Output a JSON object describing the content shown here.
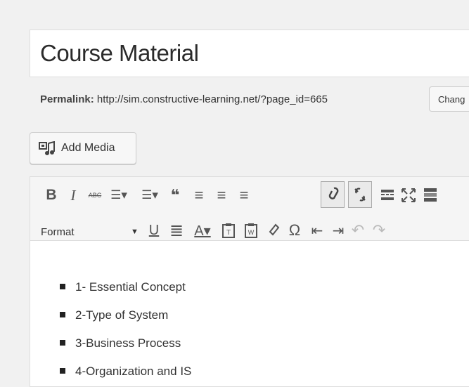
{
  "post": {
    "title": "Course Material",
    "permalink_label": "Permalink:",
    "permalink_url": "http://sim.constructive-learning.net/?page_id=665",
    "change_button": "Chang"
  },
  "media": {
    "add_media_label": "Add Media"
  },
  "toolbar": {
    "row1": [
      {
        "name": "bold-button",
        "glyph": "B"
      },
      {
        "name": "italic-button",
        "glyph": "I"
      },
      {
        "name": "strikethrough-button",
        "glyph": "ABC"
      },
      {
        "name": "bulleted-list-button",
        "glyph": "☰▾"
      },
      {
        "name": "numbered-list-button",
        "glyph": "☰▾"
      },
      {
        "name": "blockquote-button",
        "glyph": "❝"
      },
      {
        "name": "align-left-button",
        "glyph": "≡"
      },
      {
        "name": "align-center-button",
        "glyph": "≡"
      },
      {
        "name": "align-right-button",
        "glyph": "≡"
      },
      {
        "name": "insert-link-button",
        "glyph": "🔗"
      },
      {
        "name": "remove-link-button",
        "glyph": "⛓"
      },
      {
        "name": "read-more-button",
        "glyph": "▬"
      },
      {
        "name": "fullscreen-button",
        "glyph": "✕"
      },
      {
        "name": "toolbar-toggle-button",
        "glyph": "▦"
      }
    ],
    "row2": {
      "format_label": "Format",
      "buttons": [
        {
          "name": "underline-button",
          "glyph": "U"
        },
        {
          "name": "justify-button",
          "glyph": "≣"
        },
        {
          "name": "text-color-button",
          "glyph": "A▾"
        },
        {
          "name": "paste-text-button",
          "glyph": "T"
        },
        {
          "name": "clear-formatting-button",
          "glyph": "W"
        },
        {
          "name": "eraser-button",
          "glyph": "◇"
        },
        {
          "name": "special-character-button",
          "glyph": "Ω"
        },
        {
          "name": "outdent-button",
          "glyph": "⇤"
        },
        {
          "name": "indent-button",
          "glyph": "⇥"
        },
        {
          "name": "undo-button",
          "glyph": "↶"
        },
        {
          "name": "redo-button",
          "glyph": "↷"
        }
      ]
    }
  },
  "content": {
    "items": [
      "1- Essential Concept",
      "2-Type of System",
      "3-Business Process",
      "4-Organization and IS"
    ]
  },
  "colors": {
    "active_border": "#aaaaaa",
    "text": "#333333"
  }
}
